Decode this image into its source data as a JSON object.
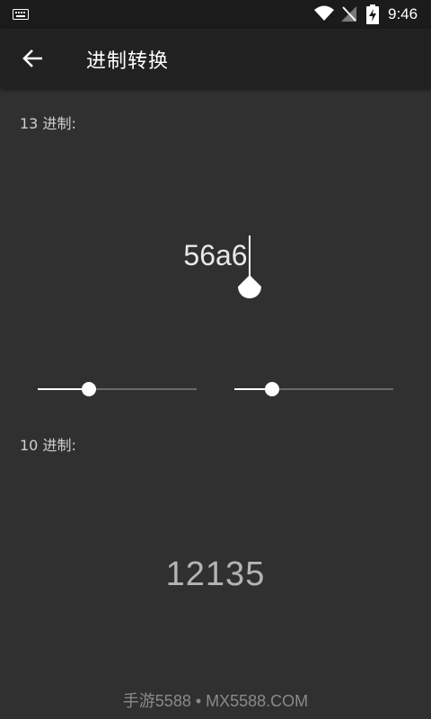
{
  "status_bar": {
    "time": "9:46",
    "icons": [
      "keyboard-icon",
      "wifi-icon",
      "no-signal-icon",
      "battery-charging-icon"
    ]
  },
  "app_bar": {
    "back_icon": "arrow-left-icon",
    "title": "进制转换"
  },
  "input_section": {
    "label": "13 进制:",
    "value": "56a6"
  },
  "sliders": [
    {
      "name": "input-base-slider",
      "fraction": 0.32
    },
    {
      "name": "output-base-slider",
      "fraction": 0.24
    }
  ],
  "output_section": {
    "label": "10 进制:",
    "value": "12135"
  },
  "watermark": "手游5588 • MX5588.COM",
  "colors": {
    "background": "#303030",
    "app_bar": "#212121",
    "status_bar": "#1b1b1b",
    "accent": "#ffffff"
  }
}
